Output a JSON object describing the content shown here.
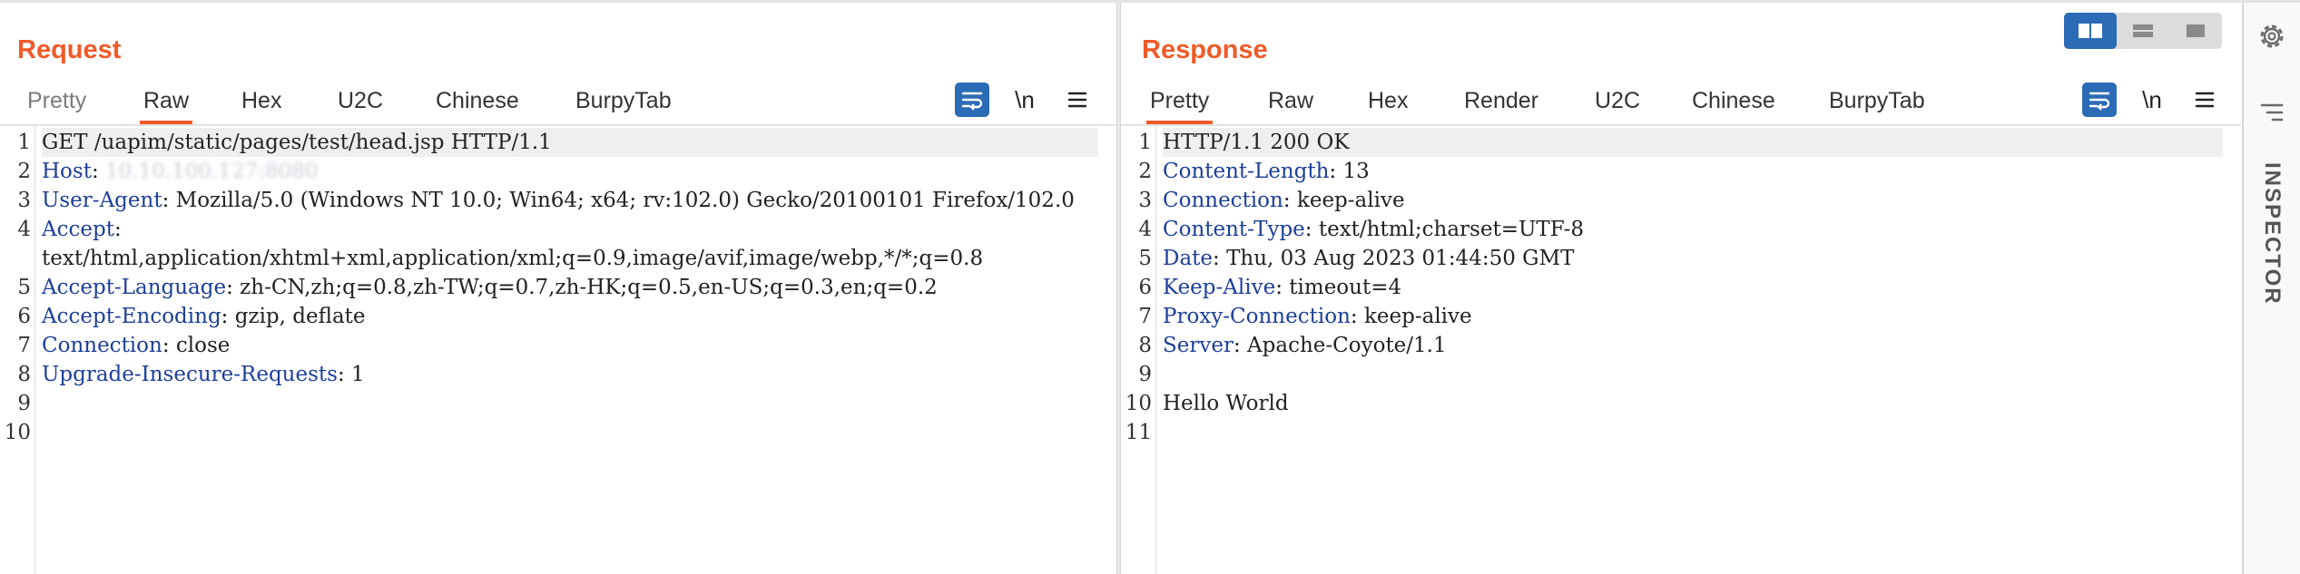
{
  "request": {
    "title": "Request",
    "tabs": [
      "Pretty",
      "Raw",
      "Hex",
      "U2C",
      "Chinese",
      "BurpyTab"
    ],
    "active_tab": "Raw",
    "newline_label": "\\n",
    "lines": [
      {
        "num": "1",
        "text": "GET /uapim/static/pages/test/head.jsp HTTP/1.1"
      },
      {
        "num": "2",
        "name": "Host",
        "value": "10.10.100.127:8080"
      },
      {
        "num": "3",
        "name": "User-Agent",
        "value": "Mozilla/5.0 (Windows NT 10.0; Win64; x64; rv:102.0) Gecko/20100101 Firefox/102.0"
      },
      {
        "num": "4",
        "name": "Accept",
        "value": "text/html,application/xhtml+xml,application/xml;q=0.9,image/avif,image/webp,*/*;q=0.8"
      },
      {
        "num": "5",
        "name": "Accept-Language",
        "value": "zh-CN,zh;q=0.8,zh-TW;q=0.7,zh-HK;q=0.5,en-US;q=0.3,en;q=0.2"
      },
      {
        "num": "6",
        "name": "Accept-Encoding",
        "value": "gzip, deflate"
      },
      {
        "num": "7",
        "name": "Connection",
        "value": "close"
      },
      {
        "num": "8",
        "name": "Upgrade-Insecure-Requests",
        "value": "1"
      },
      {
        "num": "9",
        "text": ""
      },
      {
        "num": "10",
        "text": ""
      }
    ]
  },
  "response": {
    "title": "Response",
    "tabs": [
      "Pretty",
      "Raw",
      "Hex",
      "Render",
      "U2C",
      "Chinese",
      "BurpyTab"
    ],
    "active_tab": "Pretty",
    "newline_label": "\\n",
    "lines": [
      {
        "num": "1",
        "text": "HTTP/1.1 200 OK"
      },
      {
        "num": "2",
        "name": "Content-Length",
        "value": "13"
      },
      {
        "num": "3",
        "name": "Connection",
        "value": "keep-alive"
      },
      {
        "num": "4",
        "name": "Content-Type",
        "value": "text/html;charset=UTF-8"
      },
      {
        "num": "5",
        "name": "Date",
        "value": "Thu, 03 Aug 2023 01:44:50 GMT"
      },
      {
        "num": "6",
        "name": "Keep-Alive",
        "value": "timeout=4"
      },
      {
        "num": "7",
        "name": "Proxy-Connection",
        "value": "keep-alive"
      },
      {
        "num": "8",
        "name": "Server",
        "value": "Apache-Coyote/1.1"
      },
      {
        "num": "9",
        "text": ""
      },
      {
        "num": "10",
        "text": "Hello World"
      },
      {
        "num": "11",
        "text": ""
      }
    ]
  },
  "inspector": {
    "label": "INSPECTOR"
  },
  "colors": {
    "accent": "#f05a28",
    "header_name": "#1d3f99",
    "active_button": "#2c6bb6"
  }
}
